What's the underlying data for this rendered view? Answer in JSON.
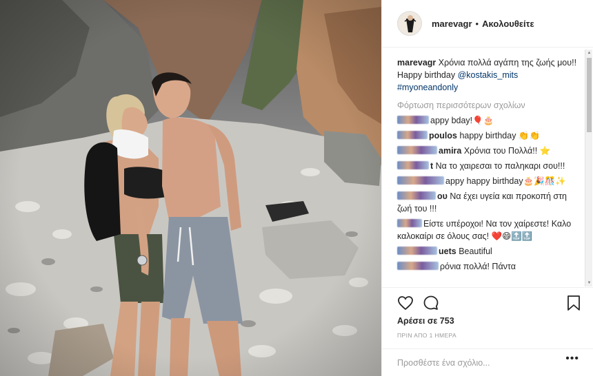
{
  "post": {
    "username": "marevagr",
    "separator": "•",
    "follow_label": "Ακολουθείτε",
    "caption_text": "Χρόνια πολλά αγάπη της ζωής μου!! Happy birthday",
    "caption_mention": "@kostakis_mits",
    "caption_hashtag": "#myoneandonly",
    "load_more_label": "Φόρτωση περισσότερων σχολίων",
    "comments": [
      {
        "user_visible": "",
        "text": "appy bday!🎈🎂"
      },
      {
        "user_visible": "poulos",
        "text": "happy birthday 👏👏"
      },
      {
        "user_visible": "amira",
        "text": "Χρόνια του Πολλά!! ⭐"
      },
      {
        "user_visible": "t",
        "text": "Να το χαιρεσαι το παληκαρι σου!!!"
      },
      {
        "user_visible": "",
        "text": "appy happy birthday🎂🎉🎊✨"
      },
      {
        "user_visible": "ου",
        "text": "Να έχει υγεία και προκοπή στη ζωή του !!!"
      },
      {
        "user_visible": "",
        "text": "Είστε υπέροχοι! Να τον χαίρεστε! Καλο καλοκαίρι σε όλους σας! ❤️😄🔝🔝"
      },
      {
        "user_visible": "uets",
        "text": "Beautiful"
      },
      {
        "user_visible": "",
        "text": "ρόνια πολλά! Πάντα"
      }
    ],
    "likes_label": "Αρέσει σε 753",
    "time_label": "ΠΡΙΝ ΑΠΟ 1 ΗΜΕΡΑ",
    "comment_placeholder": "Προσθέστε ένα σχόλιο...",
    "more_label": "•••"
  },
  "icons": {
    "like": "heart-icon",
    "comment": "comment-icon",
    "save": "bookmark-icon",
    "more": "more-options-icon"
  }
}
